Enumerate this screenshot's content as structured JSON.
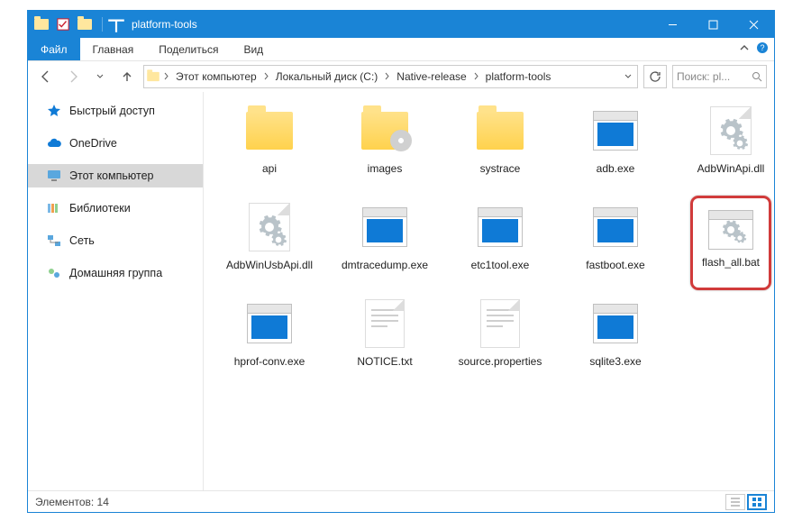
{
  "window": {
    "title": "platform-tools"
  },
  "ribbon": {
    "file": "Файл",
    "tabs": [
      "Главная",
      "Поделиться",
      "Вид"
    ]
  },
  "breadcrumb": {
    "segments": [
      "Этот компьютер",
      "Локальный диск (C:)",
      "Native-release",
      "platform-tools"
    ]
  },
  "search": {
    "placeholder": "Поиск: pl..."
  },
  "sidebar": {
    "items": [
      {
        "label": "Быстрый доступ",
        "icon": "star"
      },
      {
        "label": "OneDrive",
        "icon": "cloud"
      },
      {
        "label": "Этот компьютер",
        "icon": "monitor",
        "selected": true
      },
      {
        "label": "Библиотеки",
        "icon": "libraries"
      },
      {
        "label": "Сеть",
        "icon": "network"
      },
      {
        "label": "Домашняя группа",
        "icon": "homegroup"
      }
    ]
  },
  "files": [
    {
      "name": "api",
      "type": "folder"
    },
    {
      "name": "images",
      "type": "folder-disc"
    },
    {
      "name": "systrace",
      "type": "folder"
    },
    {
      "name": "adb.exe",
      "type": "exe"
    },
    {
      "name": "AdbWinApi.dll",
      "type": "cfg"
    },
    {
      "name": "AdbWinUsbApi.dll",
      "type": "cfg"
    },
    {
      "name": "dmtracedump.exe",
      "type": "exe"
    },
    {
      "name": "etc1tool.exe",
      "type": "exe"
    },
    {
      "name": "fastboot.exe",
      "type": "exe"
    },
    {
      "name": "flash_all.bat",
      "type": "bat",
      "highlighted": true
    },
    {
      "name": "hprof-conv.exe",
      "type": "exe"
    },
    {
      "name": "NOTICE.txt",
      "type": "txt"
    },
    {
      "name": "source.properties",
      "type": "txt"
    },
    {
      "name": "sqlite3.exe",
      "type": "exe"
    }
  ],
  "statusbar": {
    "count_label": "Элементов: 14"
  }
}
